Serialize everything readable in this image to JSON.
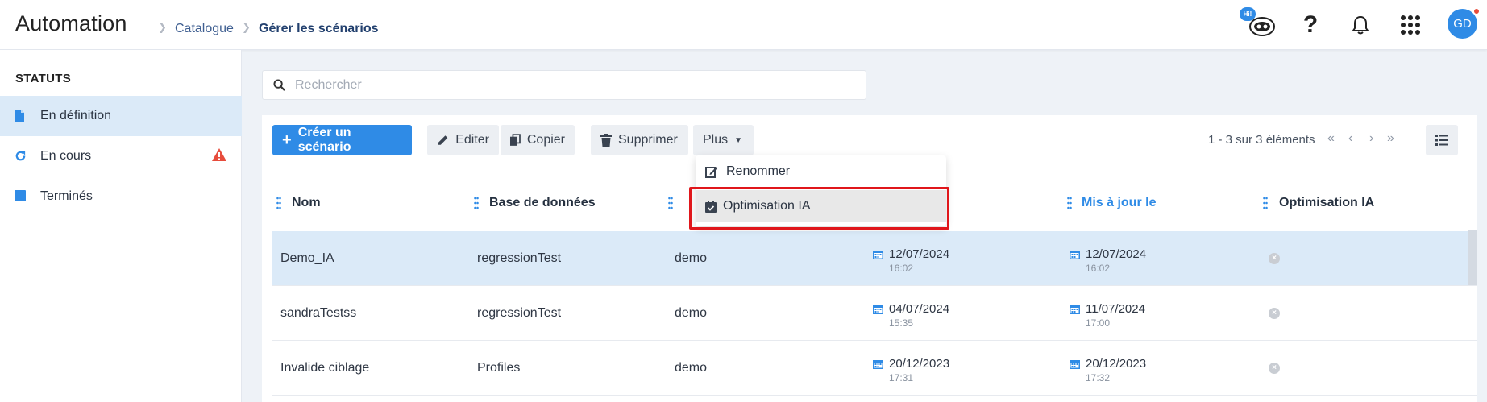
{
  "header": {
    "app_title": "Automation",
    "breadcrumb": [
      "Catalogue",
      "Gérer les scénarios"
    ],
    "hi_badge": "Hi!",
    "avatar_initials": "GD",
    "icons": [
      "assistant-icon",
      "help-icon",
      "bell-icon",
      "apps-grid-icon"
    ]
  },
  "sidebar": {
    "title": "STATUTS",
    "items": [
      {
        "label": "En définition",
        "icon": "file-icon",
        "active": true
      },
      {
        "label": "En cours",
        "icon": "refresh-icon",
        "warning": true
      },
      {
        "label": "Terminés",
        "icon": "square-icon"
      }
    ]
  },
  "search": {
    "placeholder": "Rechercher",
    "value": ""
  },
  "toolbar": {
    "create": "Créer un scénario",
    "edit": "Editer",
    "copy": "Copier",
    "delete": "Supprimer",
    "more": "Plus",
    "pagination": "1 - 3 sur 3 éléments"
  },
  "dropdown": {
    "items": [
      "Renommer",
      "Optimisation IA"
    ]
  },
  "table": {
    "columns": [
      "Nom",
      "Base de données",
      "",
      "",
      "Mis à jour le",
      "Optimisation IA"
    ],
    "rows": [
      {
        "name": "Demo_IA",
        "db": "regressionTest",
        "owner": "demo",
        "created_date": "12/07/2024",
        "created_time": "16:02",
        "updated_date": "12/07/2024",
        "updated_time": "16:02"
      },
      {
        "name": "sandraTestss",
        "db": "regressionTest",
        "owner": "demo",
        "created_date": "04/07/2024",
        "created_time": "15:35",
        "updated_date": "11/07/2024",
        "updated_time": "17:00"
      },
      {
        "name": "Invalide ciblage",
        "db": "Profiles",
        "owner": "demo",
        "created_date": "20/12/2023",
        "created_time": "17:31",
        "updated_date": "20/12/2023",
        "updated_time": "17:32"
      }
    ]
  },
  "colors": {
    "accent": "#2f8be6",
    "selected_row": "#dbeaf8",
    "highlight_box": "#e0161b",
    "warning": "#e74c3c"
  }
}
